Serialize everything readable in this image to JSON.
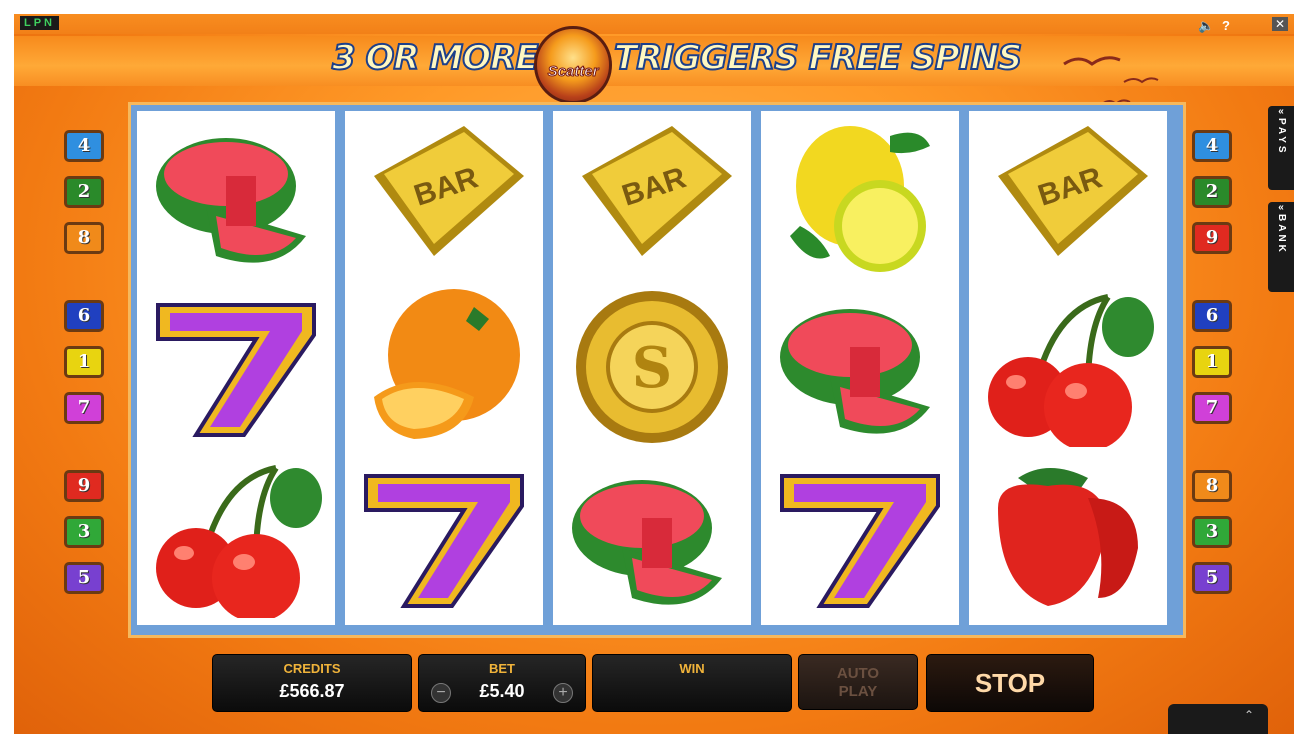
{
  "window": {
    "logo_text": "LPN",
    "sound_icon": "speaker-icon",
    "help_label": "?",
    "close_label": "✕"
  },
  "banner": {
    "left_text": "3 OR MORE",
    "scatter_label": "Scatter",
    "right_text": "TRIGGERS FREE SPINS"
  },
  "reels": [
    [
      "watermelon",
      "seven",
      "cherries"
    ],
    [
      "bar",
      "orange",
      "seven"
    ],
    [
      "bar",
      "scatter-coin",
      "watermelon"
    ],
    [
      "lemon",
      "watermelon",
      "seven"
    ],
    [
      "bar",
      "cherries",
      "strawberry"
    ]
  ],
  "bar_label": "BAR",
  "paylines": {
    "left": [
      {
        "label": "4",
        "color": "#2f8fe0"
      },
      {
        "label": "2",
        "color": "#2a8a2a"
      },
      {
        "label": "8",
        "color": "#f08a1a"
      },
      {
        "label": "6",
        "color": "#2040c0"
      },
      {
        "label": "1",
        "color": "#e8d410"
      },
      {
        "label": "7",
        "color": "#d040d8"
      },
      {
        "label": "9",
        "color": "#e02a20"
      },
      {
        "label": "3",
        "color": "#30a838"
      },
      {
        "label": "5",
        "color": "#7840d0"
      }
    ],
    "right": [
      {
        "label": "4",
        "color": "#2f8fe0"
      },
      {
        "label": "2",
        "color": "#2a8a2a"
      },
      {
        "label": "9",
        "color": "#e02a20"
      },
      {
        "label": "6",
        "color": "#2040c0"
      },
      {
        "label": "1",
        "color": "#e8d410"
      },
      {
        "label": "7",
        "color": "#d040d8"
      },
      {
        "label": "8",
        "color": "#f08a1a"
      },
      {
        "label": "3",
        "color": "#30a838"
      },
      {
        "label": "5",
        "color": "#7840d0"
      }
    ]
  },
  "side_tabs": {
    "pays": "PAYS",
    "bank": "BANK"
  },
  "controls": {
    "credits_label": "CREDITS",
    "credits_value": "£566.87",
    "bet_label": "BET",
    "bet_value": "£5.40",
    "bet_minus": "−",
    "bet_plus": "+",
    "win_label": "WIN",
    "win_value": "",
    "autoplay_label_1": "AUTO",
    "autoplay_label_2": "PLAY",
    "stop_label": "STOP"
  }
}
